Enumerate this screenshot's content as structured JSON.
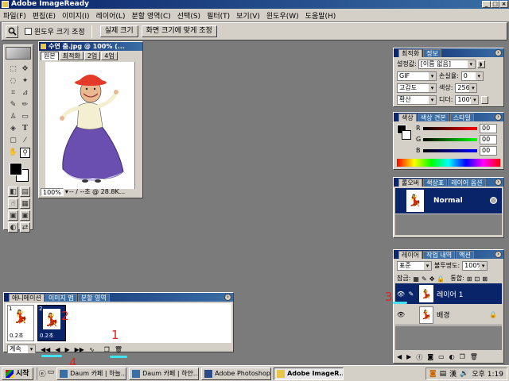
{
  "window": {
    "title": "Adobe ImageReady"
  },
  "menu": [
    "파일(F)",
    "편집(E)",
    "이미지(I)",
    "레이어(L)",
    "분할 영역(C)",
    "선택(S)",
    "필터(T)",
    "보기(V)",
    "윈도우(W)",
    "도움말(H)"
  ],
  "options_bar": {
    "checkbox_label": "윈도우 크기 조정",
    "actual_size": "실제 크기",
    "fit_on_screen": "화면 크기에 맞게 조정"
  },
  "document": {
    "title": "수연 춤.jpg @ 100% (...",
    "tabs": [
      "원본",
      "최적화",
      "2업",
      "4업"
    ],
    "zoom": "100%",
    "status": "-- / --초 @ 28.8K..."
  },
  "optimize": {
    "tabs": [
      "최적화",
      "정보"
    ],
    "settings_label": "설정값:",
    "settings_value": "[이름 없음]",
    "format": "GIF",
    "lossy_label": "손실율:",
    "lossy_value": "0",
    "reduction": "고감도",
    "colors_label": "색상:",
    "colors_value": "256",
    "dither": "확산",
    "dither_label": "디더:",
    "dither_value": "100%"
  },
  "color": {
    "tabs": [
      "색상",
      "색상 견본",
      "스타일"
    ],
    "r_label": "R",
    "r_value": "00",
    "g_label": "G",
    "g_value": "00",
    "b_label": "B",
    "b_value": "00"
  },
  "rollover": {
    "tabs": [
      "롤오버",
      "색상표",
      "레이어 옵션"
    ],
    "state": "Normal"
  },
  "layers": {
    "tabs": [
      "레이어",
      "작업 내역",
      "액션"
    ],
    "blend_mode": "표준",
    "opacity_label": "불투명도:",
    "opacity_value": "100%",
    "lock_label": "잠금:",
    "unify_label": "통합:",
    "items": [
      {
        "name": "레이어 1",
        "selected": true
      },
      {
        "name": "배경",
        "selected": false
      }
    ]
  },
  "animation": {
    "tabs": [
      "애니메이션",
      "이미지 맵",
      "분할 영역"
    ],
    "frames": [
      {
        "number": "1",
        "delay": "0.2초"
      },
      {
        "number": "2",
        "delay": "0.2초"
      }
    ],
    "loop": "계속"
  },
  "annotations": {
    "one": "1",
    "two": "2",
    "three": "3",
    "four": "4"
  },
  "taskbar": {
    "start": "시작",
    "buttons": [
      "Daum 카페 | 하늘...",
      "Daum 카페 | 하얀...",
      "Adobe Photoshop",
      "Adobe ImageR..."
    ],
    "active_index": 3,
    "clock": "오후 1:19",
    "ime": "漢"
  },
  "colors": {
    "title_blue": "#0a246a",
    "desktop": "#7b7b7b",
    "annotation_red": "#e02020",
    "annotation_cyan": "#3fe4f0"
  }
}
